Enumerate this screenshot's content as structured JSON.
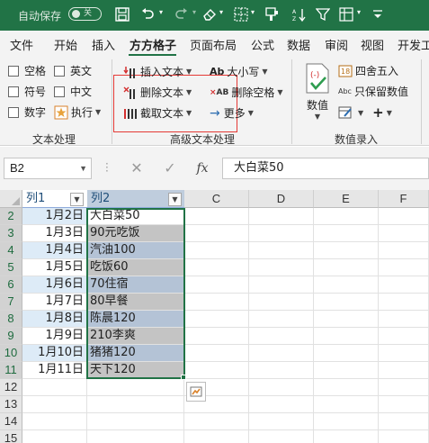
{
  "titlebar": {
    "autosave_label": "自动保存",
    "autosave_state": "关",
    "qat_icons": [
      "save-icon",
      "undo-icon",
      "redo-icon",
      "eraser-icon",
      "borders-icon",
      "format-painter-icon",
      "sort-icon",
      "filter-icon",
      "freeze-icon",
      "more-icon"
    ]
  },
  "ribbon_tabs": [
    "文件",
    "开始",
    "插入",
    "方方格子",
    "页面布局",
    "公式",
    "数据",
    "审阅",
    "视图",
    "开发工"
  ],
  "active_tab": "方方格子",
  "text_processing": {
    "checkboxes": [
      "空格",
      "英文",
      "符号",
      "中文",
      "数字"
    ],
    "execute_label": "执行",
    "group_label": "文本处理"
  },
  "advanced_text": {
    "insert_text": "插入文本",
    "delete_text": "删除文本",
    "extract_text": "截取文本",
    "case_label": "大小写",
    "delete_spaces": "删除空格",
    "more_label": "更多",
    "group_label": "高级文本处理"
  },
  "numeric_entry": {
    "numeric_label": "数值",
    "round_label": "四舍五入",
    "keep_value_label": "只保留数值",
    "group_label": "数值录入"
  },
  "formula_bar": {
    "name_box": "B2",
    "fx_label": "fx",
    "formula_value": "大白菜50"
  },
  "sheet": {
    "columns": [
      "C",
      "D",
      "E",
      "F"
    ],
    "table_headers": [
      "列1",
      "列2"
    ],
    "row_numbers": [
      "2",
      "3",
      "4",
      "5",
      "6",
      "7",
      "8",
      "9",
      "10",
      "11",
      "12",
      "13",
      "14",
      "15"
    ],
    "rows": [
      {
        "a": "1月2日",
        "b": "大白菜50"
      },
      {
        "a": "1月3日",
        "b": "90元吃饭"
      },
      {
        "a": "1月4日",
        "b": "汽油100"
      },
      {
        "a": "1月5日",
        "b": "吃饭60"
      },
      {
        "a": "1月6日",
        "b": "70住宿"
      },
      {
        "a": "1月7日",
        "b": "80早餐"
      },
      {
        "a": "1月8日",
        "b": "陈晨120"
      },
      {
        "a": "1月9日",
        "b": "210李爽"
      },
      {
        "a": "1月10日",
        "b": "猪猪120"
      },
      {
        "a": "1月11日",
        "b": "天下120"
      }
    ]
  },
  "colors": {
    "titlebar": "#217346",
    "band_light": "#ddebf7",
    "selection_fill": "#b4c3d6",
    "selection_fill_alt": "#c4c4c4",
    "table_header_text": "#1f4e79"
  }
}
